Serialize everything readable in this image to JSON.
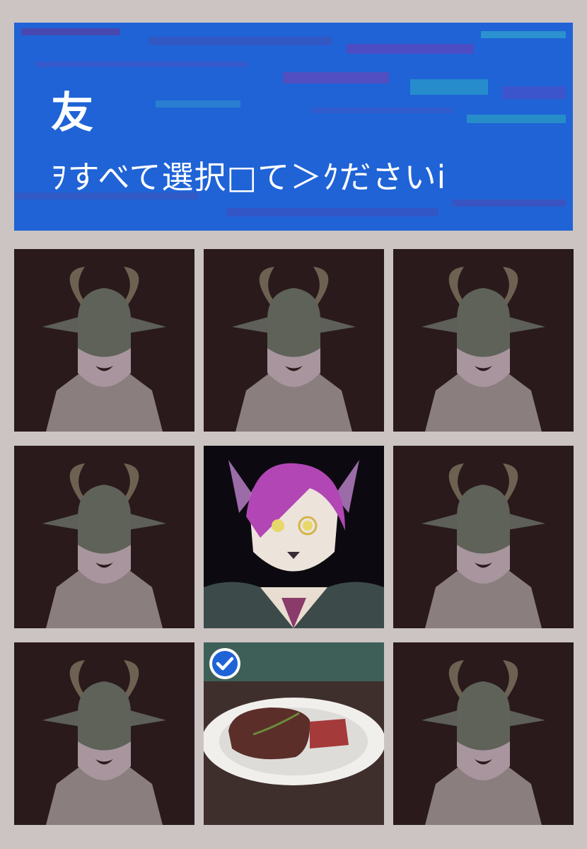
{
  "prompt": {
    "title": "友",
    "instruction": "ｦすべて選択□て＞ｸださいi"
  },
  "grid": {
    "tiles": [
      {
        "content": "goat-silhouette",
        "selected": false
      },
      {
        "content": "goat-silhouette",
        "selected": false
      },
      {
        "content": "goat-silhouette",
        "selected": false
      },
      {
        "content": "goat-silhouette",
        "selected": false
      },
      {
        "content": "wolf-character",
        "selected": false
      },
      {
        "content": "goat-silhouette",
        "selected": false
      },
      {
        "content": "goat-silhouette",
        "selected": false
      },
      {
        "content": "steak-plate",
        "selected": true
      },
      {
        "content": "goat-silhouette",
        "selected": false
      }
    ]
  },
  "colors": {
    "banner": "#1f63d6",
    "frame": "#cbc4c3",
    "check": "#1f63d6"
  }
}
